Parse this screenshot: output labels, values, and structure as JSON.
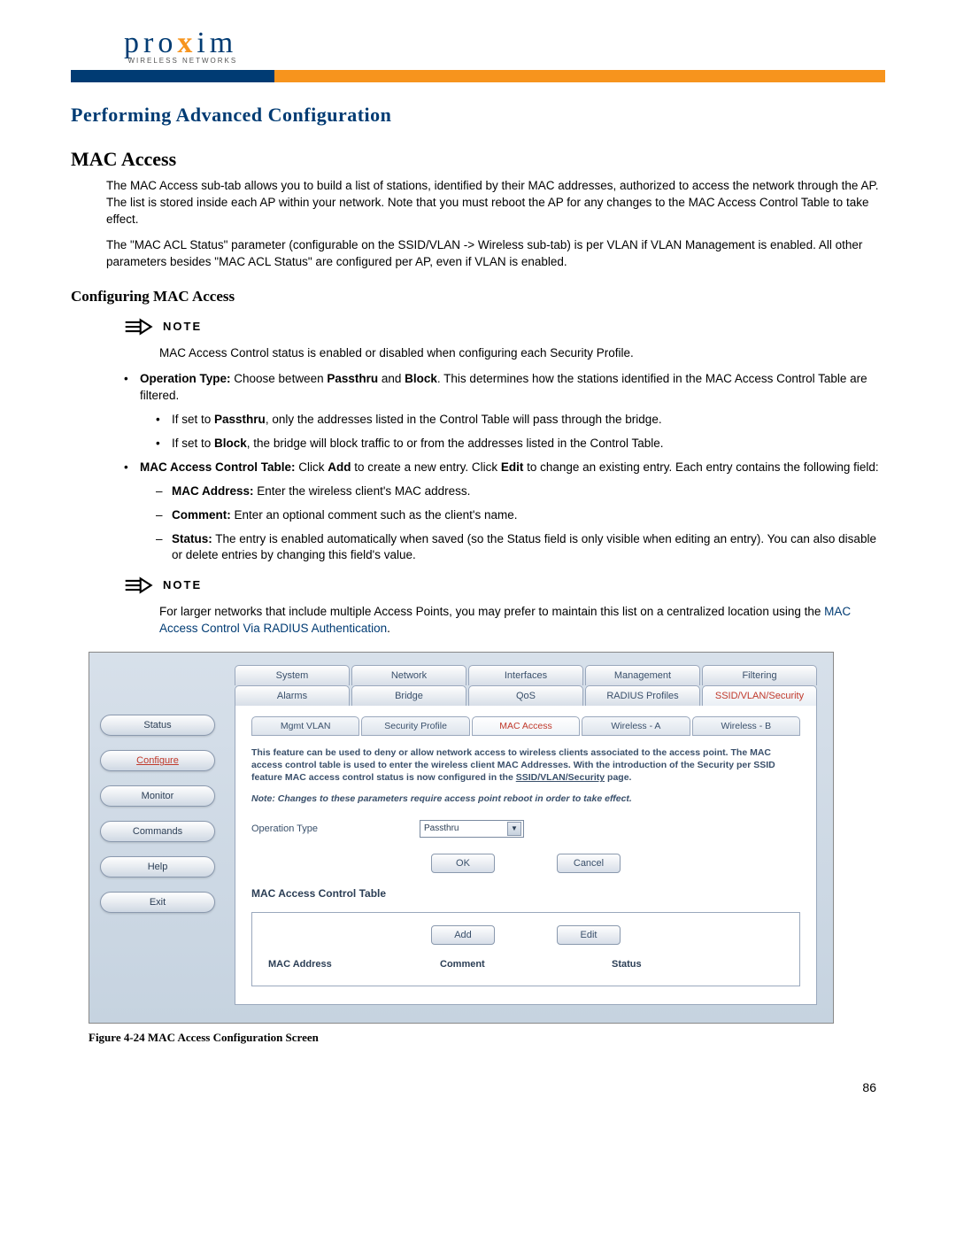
{
  "logo": {
    "text_before": "pro",
    "x": "x",
    "text_after": "im",
    "sub": "WIRELESS NETWORKS"
  },
  "section_title": "Performing Advanced Configuration",
  "h2": "MAC Access",
  "para1": "The MAC Access sub-tab allows you to build a list of stations, identified by their MAC addresses, authorized to access the network through the AP. The list is stored inside each AP within your network. Note that you must reboot the AP for any changes to the MAC Access Control Table to take effect.",
  "para2": "The \"MAC ACL Status\" parameter (configurable on the SSID/VLAN -> Wireless sub-tab) is per VLAN if VLAN Management is enabled. All other parameters besides \"MAC ACL Status\" are configured per AP, even if VLAN is enabled.",
  "h3": "Configuring MAC Access",
  "note_label": "NOTE",
  "note1_body": "MAC Access Control status is enabled or disabled when configuring each Security Profile.",
  "bullets": {
    "op_type_pre": "Operation Type:",
    "op_type_post": " Choose between ",
    "passthru": "Passthru",
    "and": " and ",
    "block": "Block",
    "op_type_tail": ". This determines how the stations identified in the MAC Access Control Table are filtered.",
    "sub1_pre": "If set to ",
    "sub1_b": "Passthru",
    "sub1_post": ", only the addresses listed in the Control Table will pass through the bridge.",
    "sub2_pre": "If set to ",
    "sub2_b": "Block",
    "sub2_post": ", the bridge will block traffic to or from the addresses listed in the Control Table.",
    "mact_pre": "MAC Access Control Table:",
    "mact_post": " Click ",
    "add": "Add",
    "mact_mid": " to create a new entry. Click ",
    "edit": "Edit",
    "mact_tail": " to change an existing entry. Each entry contains the following field:",
    "d1_b": "MAC Address:",
    "d1": " Enter the wireless client's MAC address.",
    "d2_b": "Comment:",
    "d2": " Enter an optional comment such as the client's name.",
    "d3_b": "Status:",
    "d3": " The entry is enabled automatically when saved (so the Status field is only visible when editing an entry). You can also disable or delete entries by changing this field's value."
  },
  "note2_pre": "For larger networks that include multiple Access Points, you may prefer to maintain this list on a centralized location using the ",
  "note2_link": "MAC Access Control Via RADIUS Authentication",
  "note2_post": ".",
  "screenshot": {
    "side_nav": [
      "Status",
      "Configure",
      "Monitor",
      "Commands",
      "Help",
      "Exit"
    ],
    "side_active_index": 1,
    "tabs_row1": [
      "System",
      "Network",
      "Interfaces",
      "Management",
      "Filtering"
    ],
    "tabs_row2": [
      "Alarms",
      "Bridge",
      "QoS",
      "RADIUS Profiles",
      "SSID/VLAN/Security"
    ],
    "row2_active_index": 4,
    "sub_tabs": [
      "Mgmt VLAN",
      "Security Profile",
      "MAC Access",
      "Wireless - A",
      "Wireless - B"
    ],
    "sub_active_index": 2,
    "desc1": "This feature can be used to deny or allow network access to wireless clients associated to the access point. The MAC access control table is used to enter the wireless client MAC Addresses. With the introduction of the Security per SSID feature MAC access control status is now configured in the ",
    "desc1_ul": "SSID/VLAN/Security",
    "desc1_tail": " page.",
    "note_it": "Note: Changes to these parameters require access point reboot in order to take effect.",
    "op_label": "Operation Type",
    "op_value": "Passthru",
    "ok": "OK",
    "cancel": "Cancel",
    "table_title": "MAC Access Control Table",
    "add": "Add",
    "edit": "Edit",
    "cols": [
      "MAC Address",
      "Comment",
      "Status"
    ]
  },
  "figure_caption": "Figure 4-24    MAC Access Configuration Screen",
  "page_num": "86"
}
